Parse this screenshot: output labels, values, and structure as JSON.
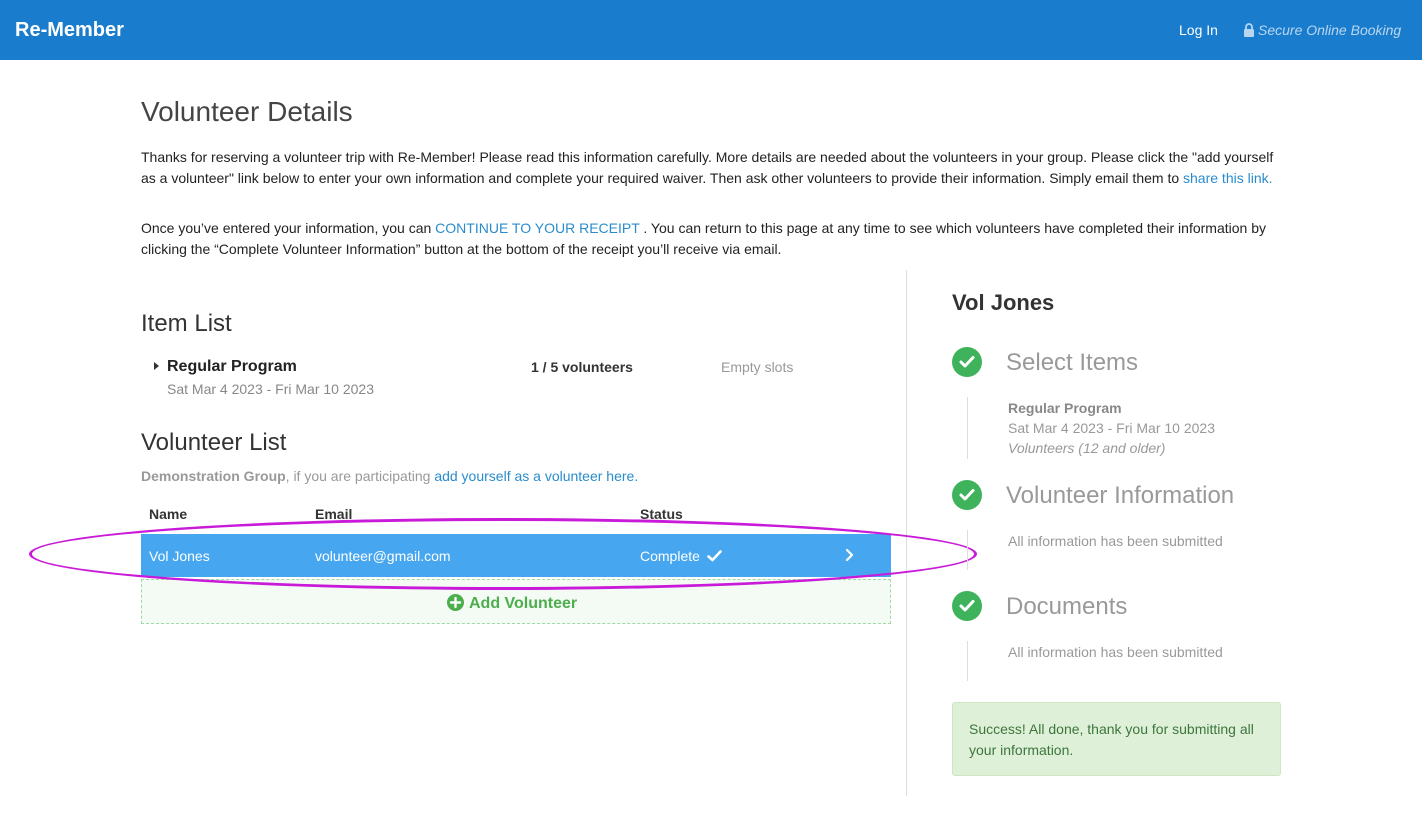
{
  "header": {
    "brand": "Re-Member",
    "login_label": "Log In",
    "secure_label": "Secure Online Booking"
  },
  "main": {
    "title": "Volunteer Details",
    "intro_p1_text": "Thanks for reserving a volunteer trip with Re-Member! Please read this information carefully. More details are needed about the volunteers in your group. Please click the \"add yourself as a volunteer\" link below to enter your own information and complete your required waiver. Then ask other volunteers to provide their information. Simply email them to ",
    "intro_p1_link": "share this link.",
    "intro_p2_pre": "Once you’ve entered your information, you can ",
    "intro_p2_link": "CONTINUE TO YOUR RECEIPT",
    "intro_p2_post": " . You can return to this page at any time to see which volunteers have completed their information by clicking the “Complete Volunteer Information” button at the bottom of the receipt you’ll receive via email."
  },
  "item_list": {
    "heading": "Item List",
    "program_name": "Regular Program",
    "program_dates": "Sat Mar 4 2023 - Fri Mar 10 2023",
    "count": "1 / 5 volunteers",
    "empty_slots": "Empty slots"
  },
  "volunteer_list": {
    "heading": "Volunteer List",
    "group_name": "Demonstration Group",
    "group_mid": ", if you are participating ",
    "add_self_link": "add yourself as a volunteer here.",
    "columns": [
      "Name",
      "Email",
      "Status"
    ],
    "rows": [
      {
        "name": "Vol Jones",
        "email": "volunteer@gmail.com",
        "status": "Complete"
      }
    ],
    "add_button_label": "Add Volunteer"
  },
  "sidebar": {
    "name": "Vol Jones",
    "steps": [
      {
        "title": "Select Items",
        "lines": [
          "Regular Program",
          "Sat Mar 4 2023 - Fri Mar 10 2023",
          "Volunteers (12 and older)"
        ]
      },
      {
        "title": "Volunteer Information",
        "lines": [
          "All information has been submitted"
        ]
      },
      {
        "title": "Documents",
        "lines": [
          "All information has been submitted"
        ]
      }
    ],
    "success_message": "Success! All done, thank you for submitting all your information."
  },
  "colors": {
    "header_bg": "#1a7ccc",
    "row_highlight": "#46a7f0",
    "success_green": "#3fb35b",
    "annotation_ellipse": "#c81ad8"
  }
}
